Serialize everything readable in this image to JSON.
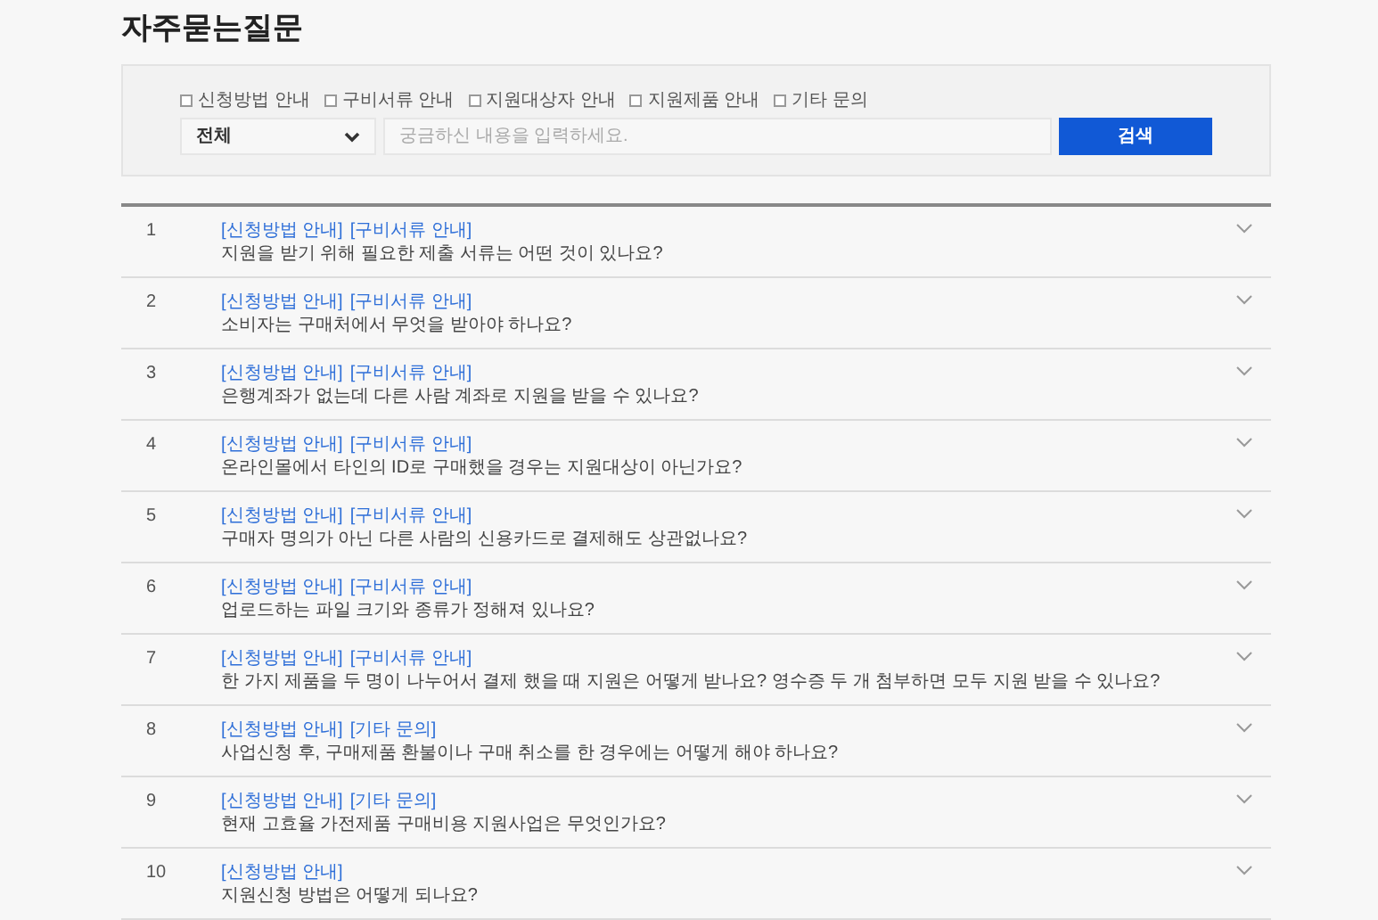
{
  "title": "자주묻는질문",
  "filters": [
    {
      "label": "신청방법 안내",
      "checked": false
    },
    {
      "label": "구비서류 안내",
      "checked": false
    },
    {
      "label": "지원대상자 안내",
      "checked": false
    },
    {
      "label": "지원제품 안내",
      "checked": false
    },
    {
      "label": "기타 문의",
      "checked": false
    }
  ],
  "category_select": {
    "value": "전체"
  },
  "search": {
    "placeholder": "궁금하신 내용을 입력하세요."
  },
  "search_button": "검색",
  "faqs": [
    {
      "number": "1",
      "tags": [
        "[신청방법 안내]",
        "[구비서류 안내]"
      ],
      "question": "지원을 받기 위해 필요한 제출 서류는 어떤 것이 있나요?",
      "expanded": false
    },
    {
      "number": "2",
      "tags": [
        "[신청방법 안내]",
        "[구비서류 안내]"
      ],
      "question": "소비자는 구매처에서 무엇을 받아야 하나요?",
      "expanded": false
    },
    {
      "number": "3",
      "tags": [
        "[신청방법 안내]",
        "[구비서류 안내]"
      ],
      "question": "은행계좌가 없는데 다른 사람 계좌로 지원을 받을 수 있나요?",
      "expanded": false
    },
    {
      "number": "4",
      "tags": [
        "[신청방법 안내]",
        "[구비서류 안내]"
      ],
      "question": "온라인몰에서 타인의 ID로 구매했을 경우는 지원대상이 아닌가요?",
      "expanded": false
    },
    {
      "number": "5",
      "tags": [
        "[신청방법 안내]",
        "[구비서류 안내]"
      ],
      "question": "구매자 명의가 아닌 다른 사람의 신용카드로 결제해도 상관없나요?",
      "expanded": false
    },
    {
      "number": "6",
      "tags": [
        "[신청방법 안내]",
        "[구비서류 안내]"
      ],
      "question": "업로드하는 파일 크기와 종류가 정해져 있나요?",
      "expanded": false
    },
    {
      "number": "7",
      "tags": [
        "[신청방법 안내]",
        "[구비서류 안내]"
      ],
      "question": "한 가지 제품을 두 명이 나누어서 결제 했을 때 지원은 어떻게 받나요? 영수증 두 개 첨부하면 모두 지원 받을 수 있나요?",
      "expanded": false
    },
    {
      "number": "8",
      "tags": [
        "[신청방법 안내]",
        "[기타 문의]"
      ],
      "question": "사업신청 후, 구매제품 환불이나 구매 취소를 한 경우에는 어떻게 해야 하나요?",
      "expanded": false
    },
    {
      "number": "9",
      "tags": [
        "[신청방법 안내]",
        "[기타 문의]"
      ],
      "question": "현재 고효율 가전제품 구매비용 지원사업은 무엇인가요?",
      "expanded": false
    },
    {
      "number": "10",
      "tags": [
        "[신청방법 안내]"
      ],
      "question": "지원신청 방법은 어떻게 되나요?",
      "expanded": false
    }
  ]
}
